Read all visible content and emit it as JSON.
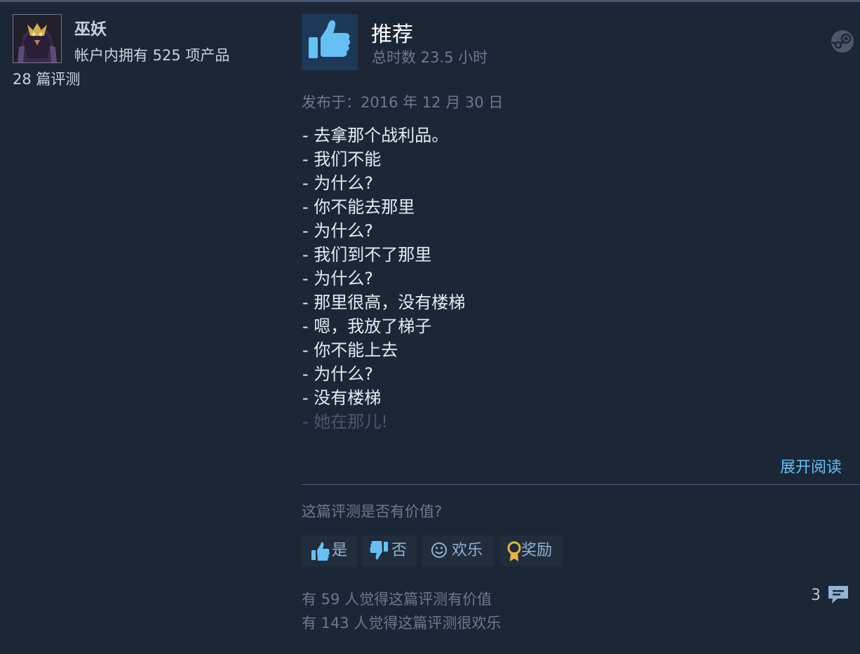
{
  "author": {
    "name": "巫妖",
    "products": "帐户内拥有 525 项产品",
    "reviews": "28 篇评测"
  },
  "review": {
    "recommendation": "推荐",
    "hours": "总时数 23.5 小时",
    "posted": "发布于：2016 年 12 月 30 日",
    "lines": [
      "- 去拿那个战利品。",
      "- 我们不能",
      "- 为什么?",
      "- 你不能去那里",
      "- 为什么?",
      "- 我们到不了那里",
      "- 为什么?",
      "- 那里很高，没有楼梯",
      "- 嗯，我放了梯子",
      "- 你不能上去",
      "- 为什么?",
      "- 没有楼梯",
      "- 她在那儿!"
    ],
    "expand_label": "展开阅读"
  },
  "feedback": {
    "question": "这篇评测是否有价值?",
    "yes_label": "是",
    "no_label": "否",
    "funny_label": "欢乐",
    "award_label": "奖励",
    "helpful_count": "有 59 人觉得这篇评测有价值",
    "funny_count": "有 143 人觉得这篇评测很欢乐",
    "comment_count": "3"
  },
  "icons": {
    "thumbs_up": "thumbs-up-icon",
    "thumbs_down": "thumbs-down-icon",
    "smiley": "smiley-icon",
    "award": "award-icon",
    "steam": "steam-logo-icon",
    "comment": "comment-icon"
  },
  "colors": {
    "background": "#1b2637",
    "link": "#66c0f4",
    "muted_text": "#6b7a8d",
    "thumb_blue": "#66c0f4",
    "award_gold": "#e7b53d"
  }
}
